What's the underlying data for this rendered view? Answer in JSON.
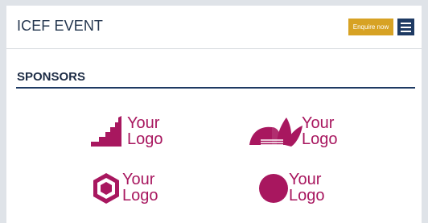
{
  "header": {
    "title": "ICEF EVENT",
    "enquire_label": "Enquire now",
    "menu_icon": "hamburger-icon"
  },
  "section": {
    "title": "SPONSORS"
  },
  "sponsors": [
    {
      "line1": "Your",
      "line2": "Logo",
      "icon": "stairs-logo-icon"
    },
    {
      "line1": "Your",
      "line2": "Logo",
      "icon": "lotus-logo-icon"
    },
    {
      "line1": "Your",
      "line2": "Logo",
      "icon": "hexagon-logo-icon"
    },
    {
      "line1": "Your",
      "line2": "Logo",
      "icon": "circle-logo-icon"
    }
  ],
  "colors": {
    "accent": "#d7a224",
    "brand": "#1e3a63",
    "logo": "#a8175f"
  }
}
